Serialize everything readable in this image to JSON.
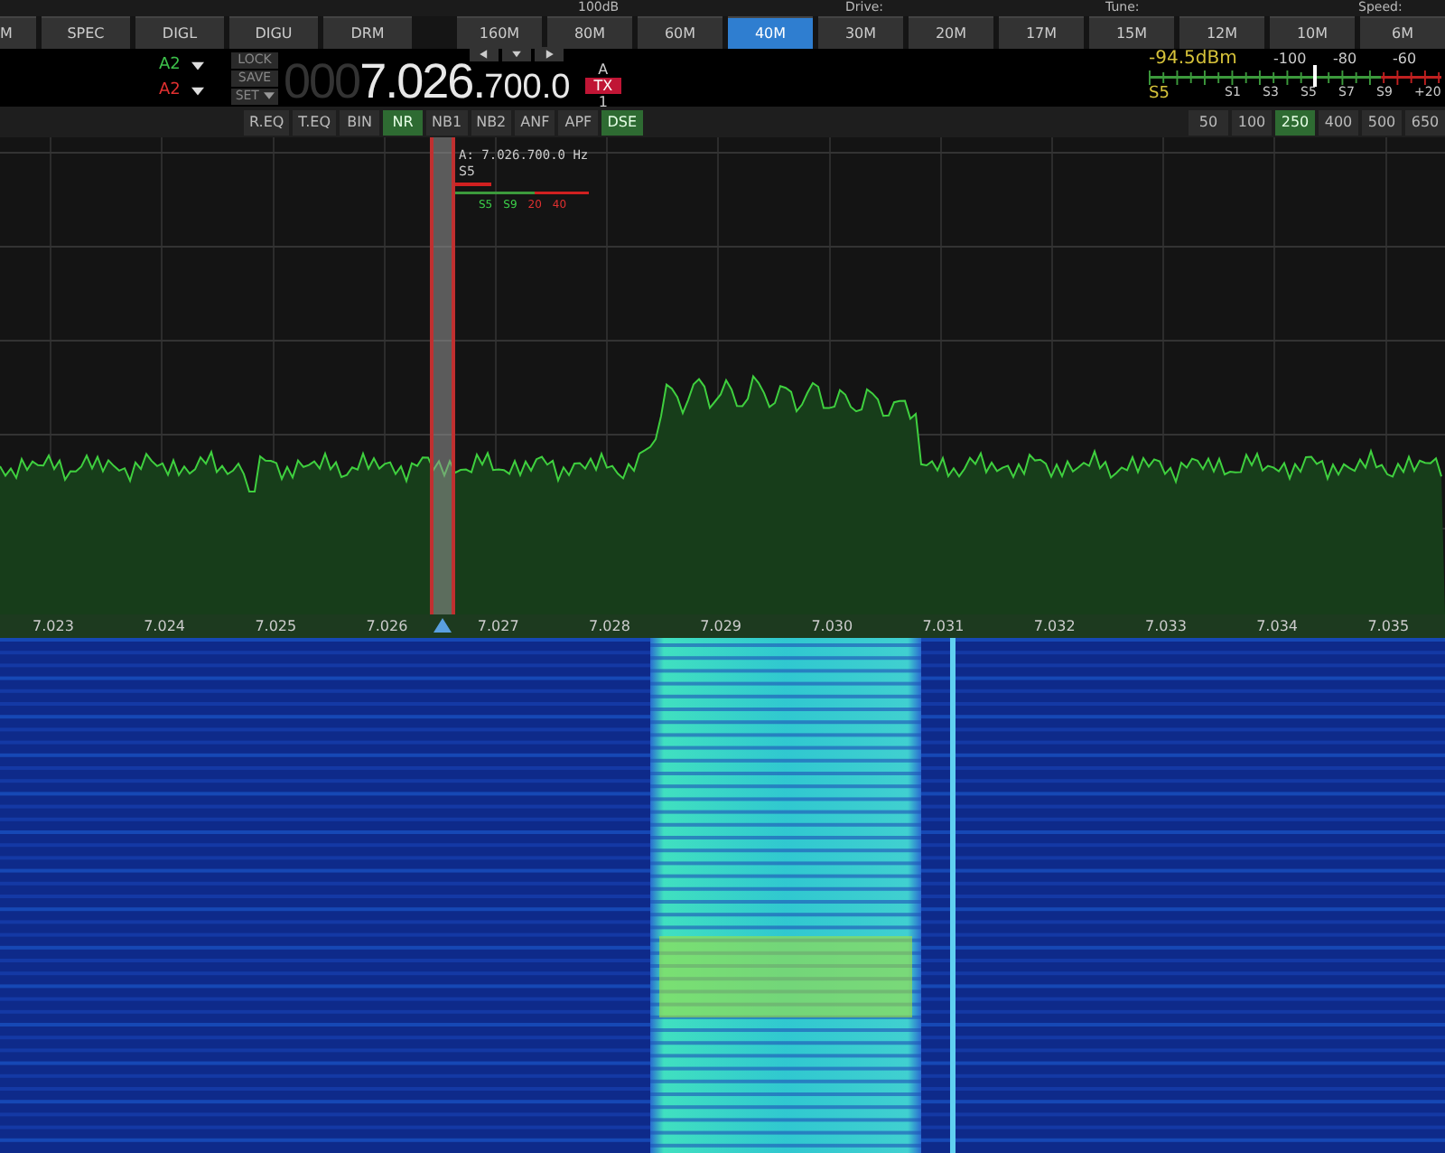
{
  "top_strip": [
    "100dB",
    "Drive:",
    "Tune:",
    "Speed:"
  ],
  "modes": [
    {
      "label": "M",
      "selected": false
    },
    {
      "label": "SPEC",
      "selected": false
    },
    {
      "label": "DIGL",
      "selected": false
    },
    {
      "label": "DIGU",
      "selected": false
    },
    {
      "label": "DRM",
      "selected": false
    }
  ],
  "bands": [
    {
      "label": "160M",
      "selected": false
    },
    {
      "label": "80M",
      "selected": false
    },
    {
      "label": "60M",
      "selected": false
    },
    {
      "label": "40M",
      "selected": true
    },
    {
      "label": "30M",
      "selected": false
    },
    {
      "label": "20M",
      "selected": false
    },
    {
      "label": "17M",
      "selected": false
    },
    {
      "label": "15M",
      "selected": false
    },
    {
      "label": "12M",
      "selected": false
    },
    {
      "label": "10M",
      "selected": false
    },
    {
      "label": "6M",
      "selected": false
    }
  ],
  "vfo": {
    "rx_label": "A2",
    "tx_label": "A2",
    "lock": "LOCK",
    "save": "SAVE",
    "set": "SET",
    "leading": "000",
    "main": "7.026.",
    "fine": "700.0",
    "vfo_name": "A",
    "tx_badge": "TX",
    "vfo_number": "1"
  },
  "meter": {
    "reading": "-94.5dBm",
    "s_reading": "S5",
    "top_scale": [
      "-100",
      "-80",
      "-60"
    ],
    "bottom_scale": [
      "S1",
      "S3",
      "S5",
      "S7",
      "S9",
      "+20"
    ],
    "level": 0.56
  },
  "dsp": [
    {
      "label": "R.EQ",
      "on": false
    },
    {
      "label": "T.EQ",
      "on": false
    },
    {
      "label": "BIN",
      "on": false
    },
    {
      "label": "NR",
      "on": true
    },
    {
      "label": "NB1",
      "on": false
    },
    {
      "label": "NB2",
      "on": false
    },
    {
      "label": "ANF",
      "on": false
    },
    {
      "label": "APF",
      "on": false
    },
    {
      "label": "DSE",
      "on": true
    }
  ],
  "filters": [
    {
      "label": "50",
      "selected": false
    },
    {
      "label": "100",
      "selected": false
    },
    {
      "label": "250",
      "selected": true
    },
    {
      "label": "400",
      "selected": false
    },
    {
      "label": "500",
      "selected": false
    },
    {
      "label": "650",
      "selected": false
    }
  ],
  "panadapter": {
    "marker_label": "A: 7.026.700.0 Hz",
    "marker_s": "S5",
    "marker_scale": [
      "S5",
      "S9",
      "20",
      "40"
    ],
    "axis": [
      "7.023",
      "7.024",
      "7.025",
      "7.026",
      "7.027",
      "7.028",
      "7.029",
      "7.030",
      "7.031",
      "7.032",
      "7.033",
      "7.034",
      "7.035"
    ]
  }
}
